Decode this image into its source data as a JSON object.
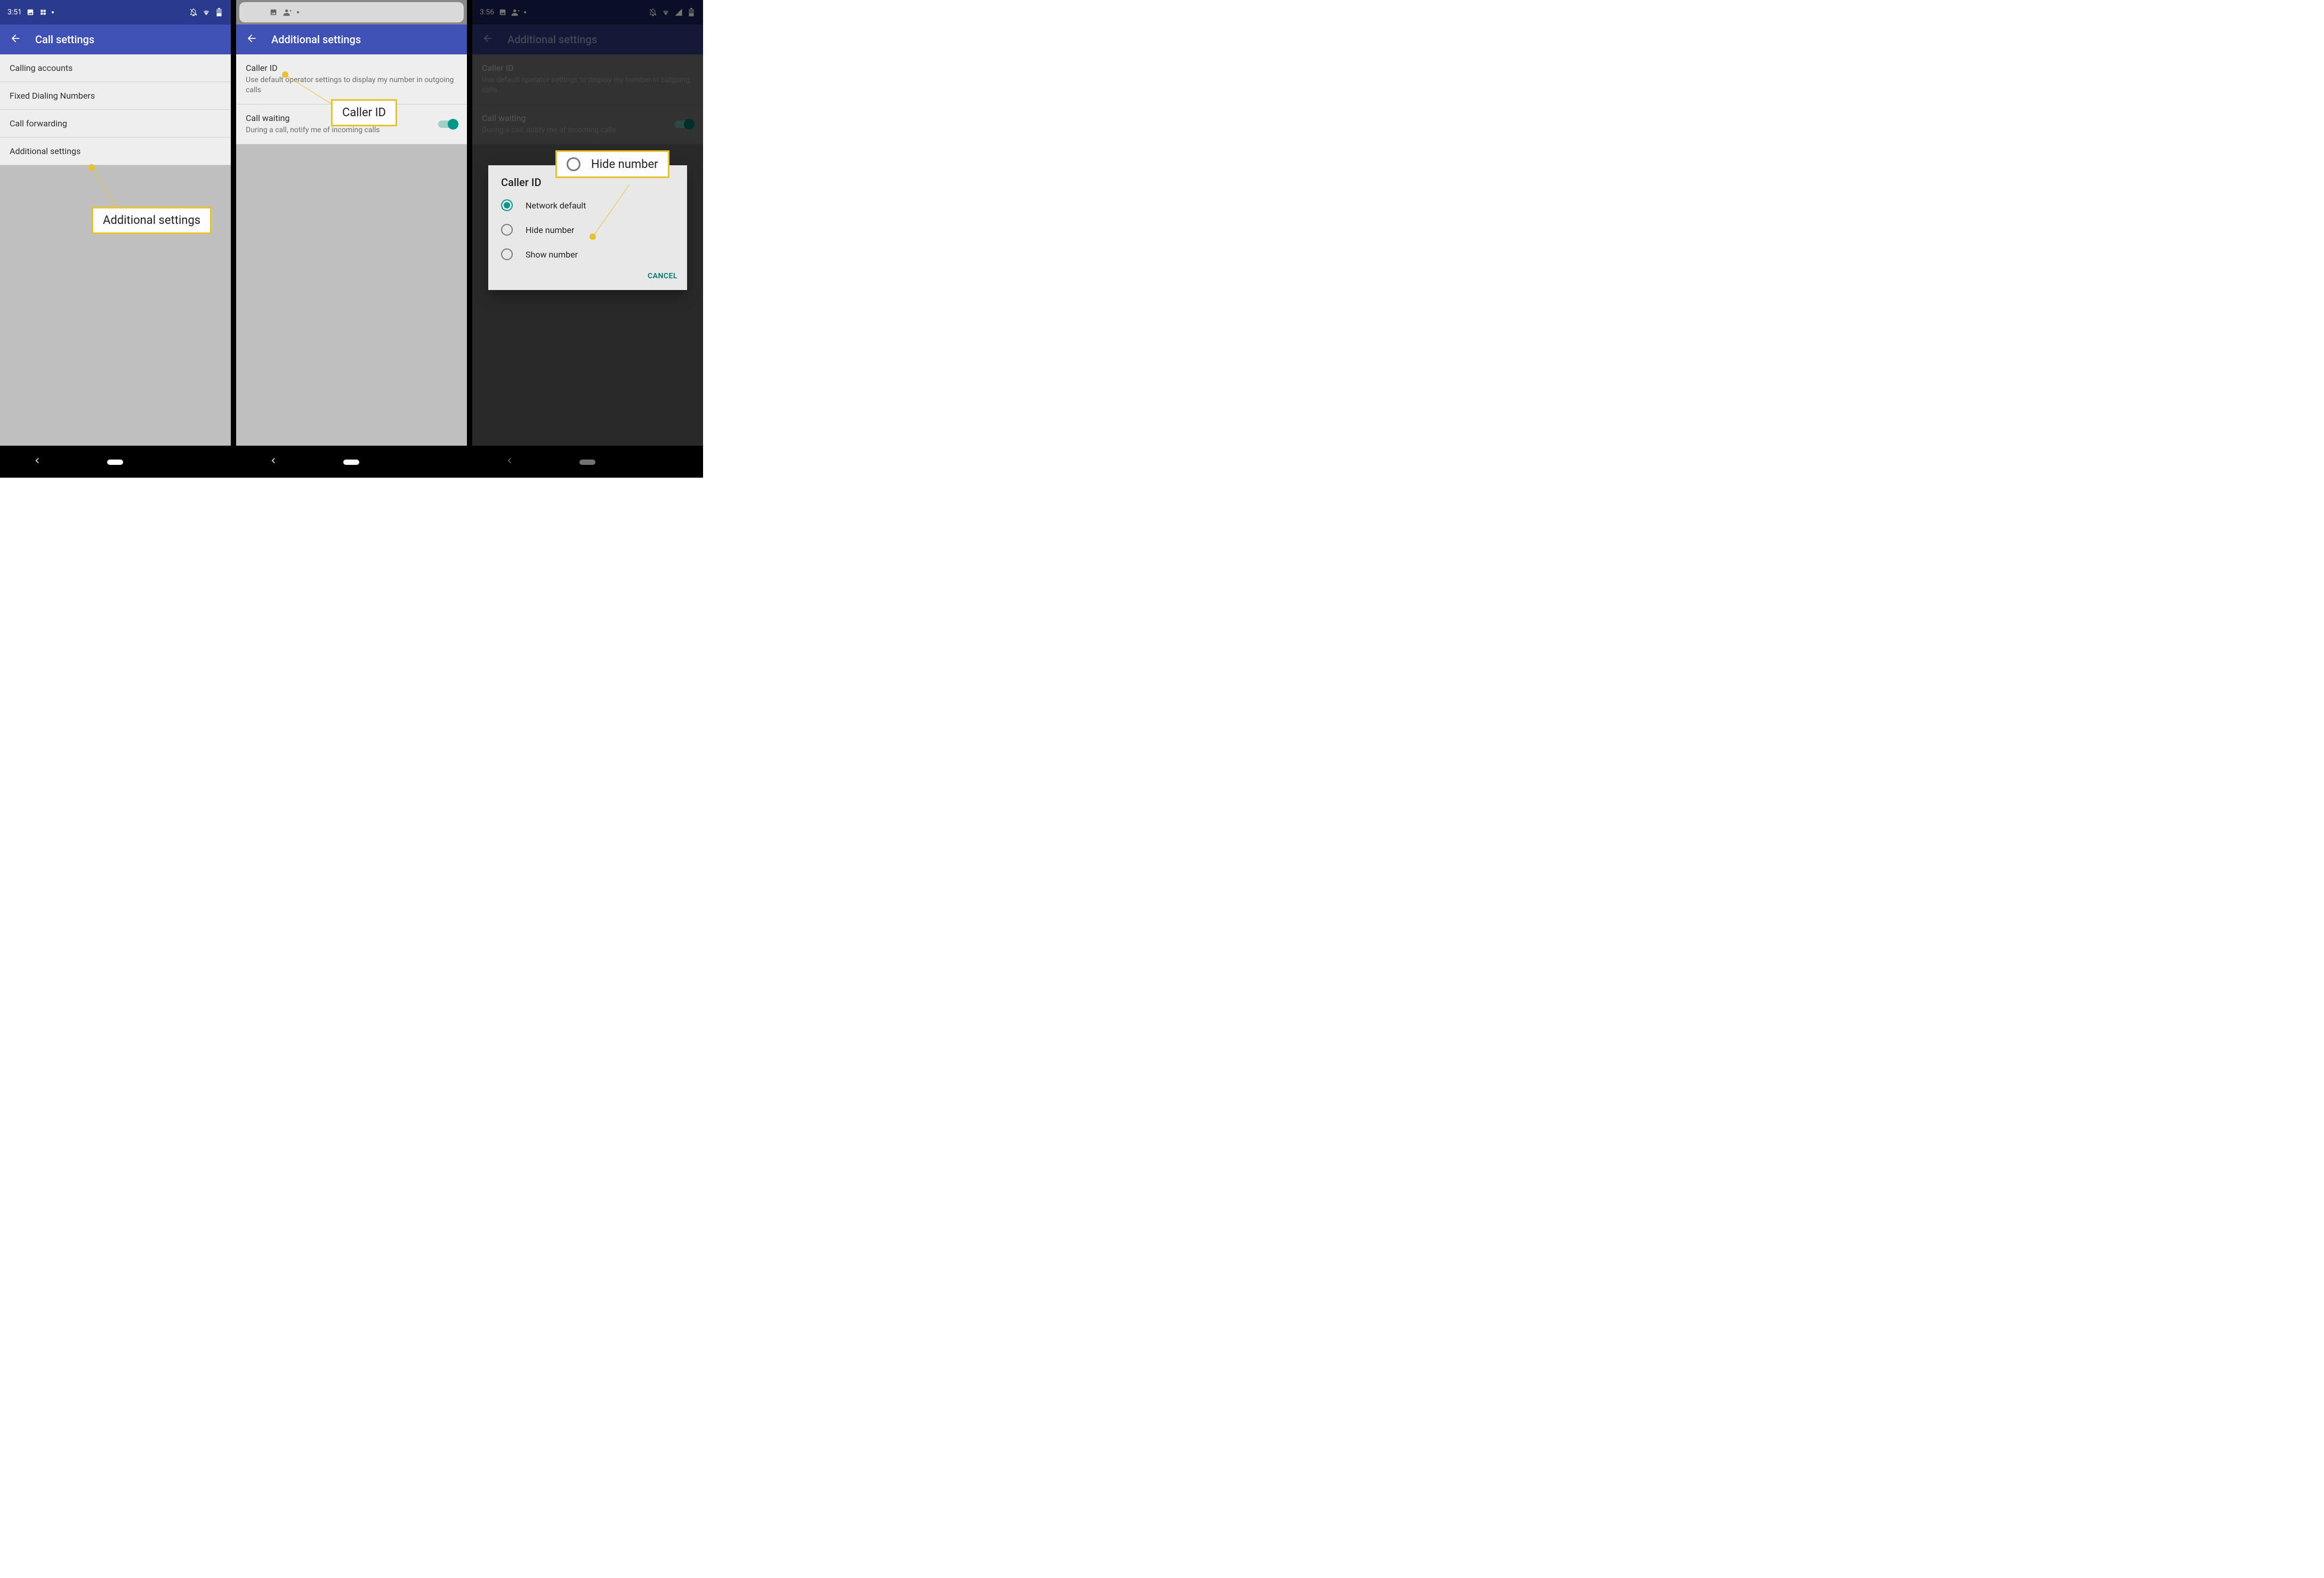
{
  "screen1": {
    "status": {
      "time": "3:51"
    },
    "titlebar": {
      "title": "Call settings"
    },
    "items": [
      {
        "label": "Calling accounts"
      },
      {
        "label": "Fixed Dialing Numbers"
      },
      {
        "label": "Call forwarding"
      },
      {
        "label": "Additional settings"
      }
    ],
    "callout": "Additional settings"
  },
  "screen2": {
    "titlebar": {
      "title": "Additional settings"
    },
    "caller_id": {
      "primary": "Caller ID",
      "secondary": "Use default operator settings to display my number in outgoing calls"
    },
    "call_waiting": {
      "primary": "Call waiting",
      "secondary": "During a call, notify me of incoming calls"
    },
    "callout": "Caller ID"
  },
  "screen3": {
    "status": {
      "time": "3:56"
    },
    "titlebar": {
      "title": "Additional settings"
    },
    "caller_id": {
      "primary": "Caller ID",
      "secondary": "Use default operator settings to display my number in outgoing calls"
    },
    "call_waiting": {
      "primary": "Call waiting",
      "secondary": "During a call, notify me of incoming calls"
    },
    "dialog": {
      "title": "Caller ID",
      "options": [
        {
          "label": "Network default",
          "selected": true
        },
        {
          "label": "Hide number",
          "selected": false
        },
        {
          "label": "Show number",
          "selected": false
        }
      ],
      "cancel": "CANCEL"
    },
    "callout": "Hide number"
  }
}
